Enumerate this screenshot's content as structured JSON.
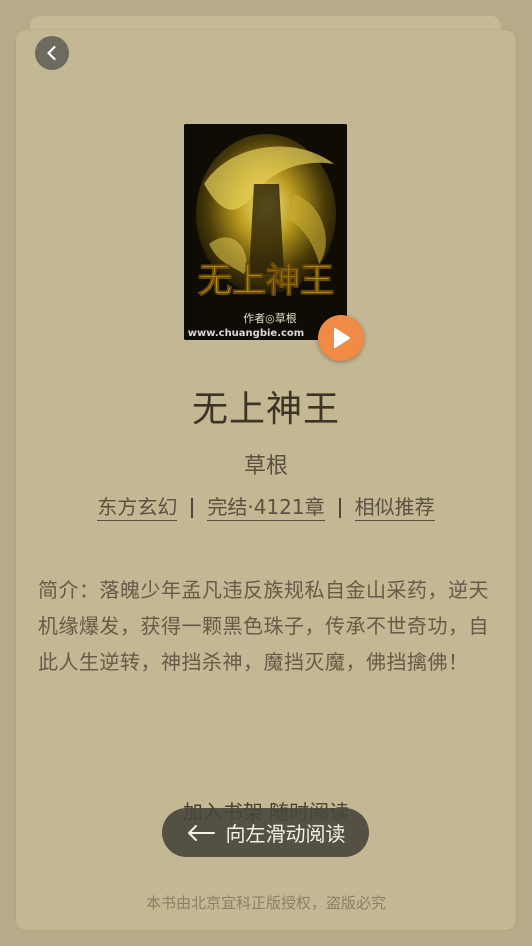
{
  "book": {
    "title": "无上神王",
    "author": "草根",
    "cover": {
      "title_art": "无上神王",
      "author_line": "作者◎草根",
      "watermark": "www.chuangbie.com"
    },
    "tags": [
      "东方玄幻",
      "完结·4121章",
      "相似推荐"
    ],
    "summary": "简介：落魄少年孟凡违反族规私自金山采药，逆天机缘爆发，获得一颗黑色珠子，传承不世奇功，自此人生逆转，神挡杀神，魔挡灭魔，佛挡擒佛！"
  },
  "actions": {
    "add_shelf_hint": "加入书架 随时阅读",
    "swipe_label": "向左滑动阅读"
  },
  "footer": {
    "copyright": "本书由北京宜科正版授权，盗版必究"
  },
  "colors": {
    "page_bg": "#b8aa88",
    "sheet_bg": "#c4b793",
    "play_accent": "#ef8b45",
    "swipe_bg": "#49453c"
  },
  "icons": [
    "chevron-left-icon",
    "play-icon",
    "arrow-left-icon"
  ]
}
